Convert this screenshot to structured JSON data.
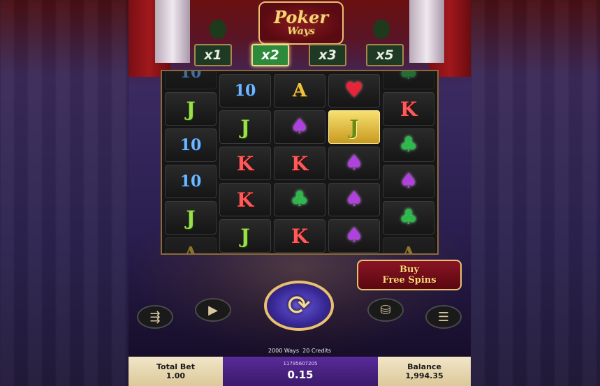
{
  "logo": {
    "line1": "Poker",
    "line2": "Ways"
  },
  "multipliers": [
    {
      "label": "x1",
      "active": false
    },
    {
      "label": "x2",
      "active": true
    },
    {
      "label": "x3",
      "active": false
    },
    {
      "label": "x5",
      "active": false
    }
  ],
  "reels": [
    [
      "10",
      "J",
      "10",
      "10",
      "J",
      "A"
    ],
    [
      "10",
      "J",
      "K",
      "K",
      "J"
    ],
    [
      "A",
      "spade",
      "K",
      "club",
      "K"
    ],
    [
      "heart",
      "J",
      "spade",
      "spade",
      "spade"
    ],
    [
      "club",
      "K",
      "club",
      "spade",
      "club",
      "A"
    ]
  ],
  "highlighted_cell": {
    "reel": 3,
    "row": 1,
    "symbol": "J"
  },
  "buy_free_spins": {
    "line1": "Buy",
    "line2": "Free Spins"
  },
  "controls": {
    "turbo_icon": "turbo-icon",
    "autoplay_icon": "autoplay-icon",
    "spin_icon": "spin-arrows-icon",
    "coins_icon": "coins-icon",
    "menu_icon": "menu-icon"
  },
  "info": {
    "ways": "2000 Ways",
    "credits": "20 Credits"
  },
  "bottom_bar": {
    "total_bet_label": "Total Bet",
    "total_bet_value": "1.00",
    "round_id": "11795607205",
    "win_value": "0.15",
    "balance_label": "Balance",
    "balance_value": "1,994.35"
  },
  "colors": {
    "gold": "#e8c070",
    "purple": "#5a2a9a",
    "panel_light": "#f2e6c8"
  }
}
